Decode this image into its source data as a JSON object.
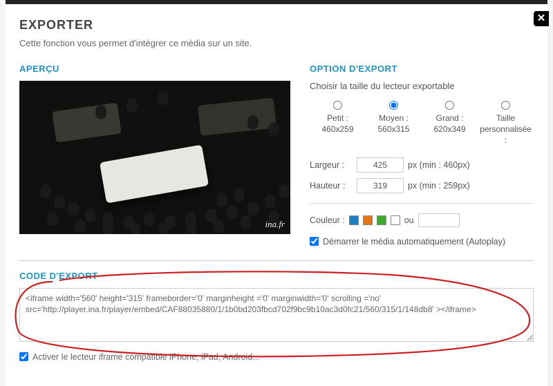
{
  "title": "EXPORTER",
  "subtitle": "Cette fonction vous permet d'intégrer ce média sur un site.",
  "preview_heading": "APERÇU",
  "watermark": "ina.fr",
  "options": {
    "heading": "OPTION D'EXPORT",
    "choose_text": "Choisir la taille du lecteur exportable",
    "sizes": [
      {
        "label": "Petit :",
        "dim": "460x259",
        "checked": false
      },
      {
        "label": "Moyen :",
        "dim": "560x315",
        "checked": true
      },
      {
        "label": "Grand :",
        "dim": "620x349",
        "checked": false
      },
      {
        "label": "Taille",
        "dim": "personnalisée :",
        "checked": false
      }
    ],
    "width_label": "Largeur :",
    "width_value": "425",
    "width_hint": "px (min : 460px)",
    "height_label": "Hauteur :",
    "height_value": "319",
    "height_hint": "px (min : 259px)",
    "color_label": "Couleur :",
    "or_label": "ou",
    "color_value": "",
    "autoplay_label": "Démarrer le média automatiquement (Autoplay)",
    "autoplay_checked": true
  },
  "export": {
    "heading": "CODE D'EXPORT",
    "code": "<iframe width='560' height='315' frameborder='0' marginheight ='0' marginwidth='0' scrolling ='no' src='http://player.ina.fr/player/embed/CAF88035880/1/1b0bd203fbcd702f9bc9b10ac3d0fc21/560/315/1/148db8' ></iframe>"
  },
  "footer": {
    "iframe_compat_label": "Activer le lecteur iframe compatible iPhone, iPad, Android...",
    "iframe_compat_checked": true
  }
}
